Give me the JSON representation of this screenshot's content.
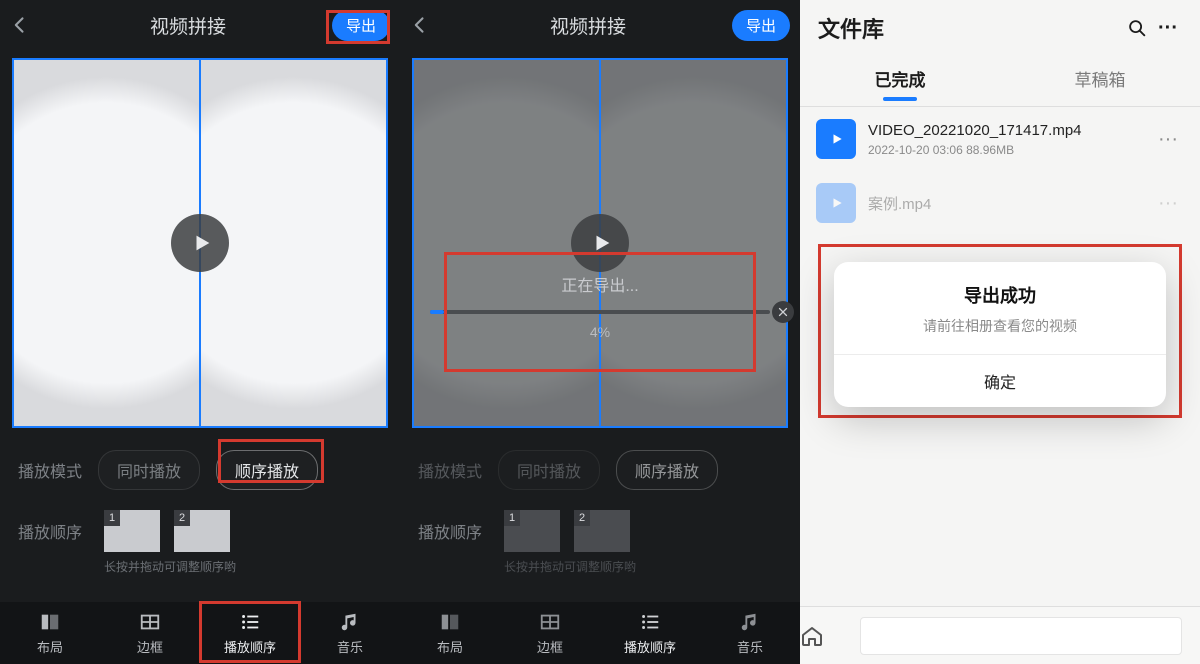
{
  "pane1": {
    "title": "视频拼接",
    "export_label": "导出",
    "mode_label": "播放模式",
    "mode_options": {
      "simul": "同时播放",
      "seq": "顺序播放"
    },
    "order_label": "播放顺序",
    "thumbs": [
      "1",
      "2"
    ],
    "hint": "长按并拖动可调整顺序哟",
    "tabs": {
      "layout": "布局",
      "border": "边框",
      "play": "播放顺序",
      "music": "音乐"
    }
  },
  "pane2": {
    "title": "视频拼接",
    "export_label": "导出",
    "mode_label": "播放模式",
    "mode_options": {
      "simul": "同时播放",
      "seq": "顺序播放"
    },
    "order_label": "播放顺序",
    "thumbs": [
      "1",
      "2"
    ],
    "hint": "长按并拖动可调整顺序哟",
    "tabs": {
      "layout": "布局",
      "border": "边框",
      "play": "播放顺序",
      "music": "音乐"
    },
    "exporting": {
      "label": "正在导出...",
      "percent": "4%"
    }
  },
  "pane3": {
    "title": "文件库",
    "tabs": {
      "done": "已完成",
      "draft": "草稿箱"
    },
    "file1": {
      "name": "VIDEO_20221020_171417.mp4",
      "meta": "2022-10-20   03:06   88.96MB"
    },
    "file2": {
      "name": "案例.mp4"
    },
    "modal": {
      "title": "导出成功",
      "subtitle": "请前往相册查看您的视频",
      "ok": "确定"
    }
  }
}
